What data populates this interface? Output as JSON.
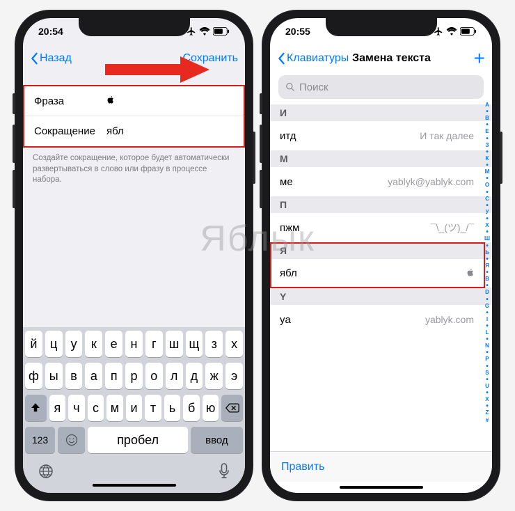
{
  "watermark": "Яблык",
  "leftPhone": {
    "time": "20:54",
    "back": "Назад",
    "save": "Сохранить",
    "phraseLabel": "Фраза",
    "phraseValue": "",
    "shortcutLabel": "Сокращение",
    "shortcutValue": "ябл",
    "help": "Создайте сокращение, которое будет автоматически развертываться в слово или фразу в процессе набора.",
    "keyboard": {
      "r1": [
        "й",
        "ц",
        "у",
        "к",
        "е",
        "н",
        "г",
        "ш",
        "щ",
        "з",
        "х"
      ],
      "r2": [
        "ф",
        "ы",
        "в",
        "а",
        "п",
        "р",
        "о",
        "л",
        "д",
        "ж",
        "э"
      ],
      "r3": [
        "я",
        "ч",
        "с",
        "м",
        "и",
        "т",
        "ь",
        "б",
        "ю"
      ],
      "num": "123",
      "space": "Пробел",
      "enter": "Ввод"
    }
  },
  "rightPhone": {
    "time": "20:55",
    "back": "Клавиатуры",
    "title": "Замена текста",
    "searchPlaceholder": "Поиск",
    "sections": [
      {
        "hdr": "И",
        "rows": [
          {
            "k": "итд",
            "v": "И так далее"
          }
        ]
      },
      {
        "hdr": "М",
        "rows": [
          {
            "k": "ме",
            "v": "yablyk@yablyk.com"
          }
        ]
      },
      {
        "hdr": "П",
        "rows": [
          {
            "k": "пжм",
            "v": "¯\\_(ツ)_/¯"
          }
        ]
      },
      {
        "hdr": "Я",
        "rows": [
          {
            "k": "ябл",
            "v": ""
          }
        ],
        "hl": true
      },
      {
        "hdr": "Y",
        "rows": [
          {
            "k": "ya",
            "v": "yablyk.com"
          }
        ]
      }
    ],
    "edit": "Править",
    "index": [
      "А",
      "•",
      "В",
      "•",
      "Е",
      "•",
      "З",
      "•",
      "К",
      "•",
      "М",
      "•",
      "О",
      "•",
      "С",
      "•",
      "У",
      "•",
      "Х",
      "•",
      "Ш",
      "•",
      "Ь",
      "•",
      "Я",
      "•",
      "B",
      "•",
      "D",
      "•",
      "G",
      "•",
      "I",
      "•",
      "L",
      "•",
      "N",
      "•",
      "P",
      "•",
      "S",
      "•",
      "U",
      "•",
      "X",
      "•",
      "Z",
      "#"
    ]
  }
}
